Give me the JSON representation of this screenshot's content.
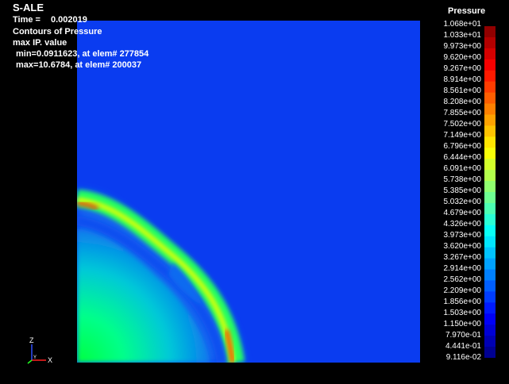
{
  "header": {
    "app": "S-ALE",
    "time_label": "Time =",
    "time_value": "0.002019",
    "contours": "Contours of Pressure",
    "mode": "max IP. value",
    "min_line": "min=0.0911623, at elem# 277854",
    "max_line": "max=10.6784, at elem# 200037"
  },
  "legend": {
    "title": "Pressure",
    "labels": [
      "1.068e+01",
      "1.033e+01",
      "9.973e+00",
      "9.620e+00",
      "9.267e+00",
      "8.914e+00",
      "8.561e+00",
      "8.208e+00",
      "7.855e+00",
      "7.502e+00",
      "7.149e+00",
      "6.796e+00",
      "6.444e+00",
      "6.091e+00",
      "5.738e+00",
      "5.385e+00",
      "5.032e+00",
      "4.679e+00",
      "4.326e+00",
      "3.973e+00",
      "3.620e+00",
      "3.267e+00",
      "2.914e+00",
      "2.562e+00",
      "2.209e+00",
      "1.856e+00",
      "1.503e+00",
      "1.150e+00",
      "7.970e-01",
      "4.441e-01",
      "9.116e-02"
    ]
  },
  "triad": {
    "z": "Z",
    "x": "X",
    "y": "Y"
  },
  "colors": {
    "background": "#000000",
    "field": "#0a3cf0",
    "front_peak": "#ff3a00",
    "front": "#3cff20",
    "inner": "#0aa0e8",
    "core": "#00ff8a"
  }
}
